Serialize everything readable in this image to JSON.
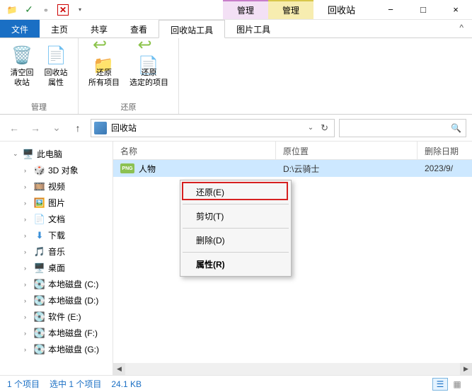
{
  "titlebar": {
    "tabs": [
      {
        "label": "管理",
        "variant": "purple"
      },
      {
        "label": "管理",
        "variant": "yellow"
      }
    ],
    "title": "回收站",
    "minimize": "−",
    "maximize": "□",
    "close": "×"
  },
  "tabs": {
    "file": "文件",
    "home": "主页",
    "share": "共享",
    "view": "查看",
    "recycle": "回收站工具",
    "pictools": "图片工具",
    "help": "^"
  },
  "ribbon": {
    "group_manage": {
      "name": "管理",
      "empty_l1": "清空回",
      "empty_l2": "收站",
      "props_l1": "回收站",
      "props_l2": "属性"
    },
    "group_restore": {
      "name": "还原",
      "all_l1": "还原",
      "all_l2": "所有项目",
      "sel_l1": "还原",
      "sel_l2": "选定的项目"
    }
  },
  "address": {
    "path": "回收站",
    "back": "←",
    "fwd": "→",
    "up": "↑",
    "drop": "⌄",
    "refresh": "↻",
    "search_icon": "🔍"
  },
  "nav": {
    "thispc": "此电脑",
    "items": [
      {
        "label": "3D 对象",
        "icon": "3d"
      },
      {
        "label": "视频",
        "icon": "video"
      },
      {
        "label": "图片",
        "icon": "pic"
      },
      {
        "label": "文档",
        "icon": "doc"
      },
      {
        "label": "下载",
        "icon": "dl"
      },
      {
        "label": "音乐",
        "icon": "music"
      },
      {
        "label": "桌面",
        "icon": "desktop"
      },
      {
        "label": "本地磁盘 (C:)",
        "icon": "disk"
      },
      {
        "label": "本地磁盘 (D:)",
        "icon": "disk"
      },
      {
        "label": "软件 (E:)",
        "icon": "disk"
      },
      {
        "label": "本地磁盘 (F:)",
        "icon": "disk"
      },
      {
        "label": "本地磁盘 (G:)",
        "icon": "disk"
      }
    ]
  },
  "files": {
    "headers": {
      "name": "名称",
      "location": "原位置",
      "date": "删除日期"
    },
    "rows": [
      {
        "icon_label": "PNG",
        "name": "人物",
        "location": "D:\\云骑士",
        "date": "2023/9/"
      }
    ]
  },
  "context_menu": {
    "restore": "还原(E)",
    "cut": "剪切(T)",
    "delete": "删除(D)",
    "properties": "属性(R)"
  },
  "status": {
    "count": "1 个项目",
    "selection": "选中 1 个项目",
    "size": "24.1 KB"
  }
}
